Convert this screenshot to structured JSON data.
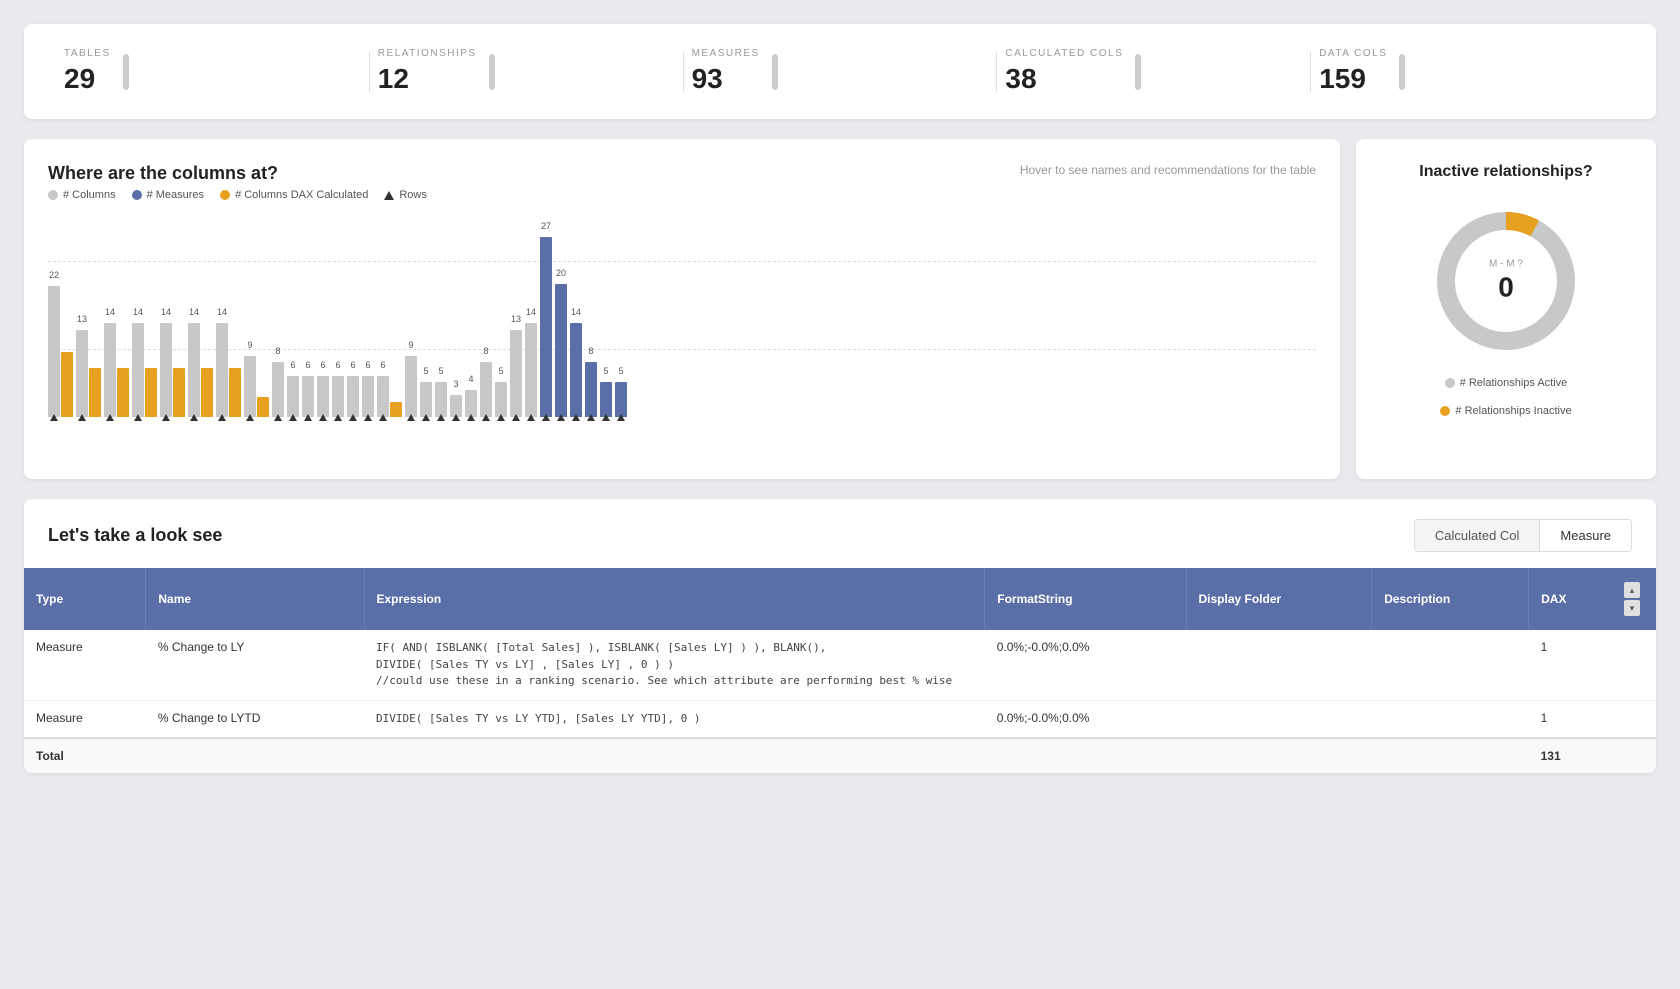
{
  "stats": {
    "items": [
      {
        "label": "TABLES",
        "value": "29"
      },
      {
        "label": "RELATIONSHIPS",
        "value": "12"
      },
      {
        "label": "MEASURES",
        "value": "93"
      },
      {
        "label": "CALCULATED COLS",
        "value": "38"
      },
      {
        "label": "DATA COLS",
        "value": "159"
      }
    ]
  },
  "columnChart": {
    "title": "Where are the columns at?",
    "subtitle": "Hover to see names and recommendations for the table",
    "legend": [
      {
        "label": "# Columns",
        "type": "dot",
        "color": "#c8c8c8"
      },
      {
        "label": "# Measures",
        "type": "dot",
        "color": "#5a6fa8"
      },
      {
        "label": "# Columns DAX Calculated",
        "type": "dot",
        "color": "#e8a020"
      },
      {
        "label": "Rows",
        "type": "triangle"
      }
    ],
    "bars": [
      {
        "grey": 120,
        "orange": 60,
        "blue": 0,
        "greyLabel": "22",
        "orangeLabel": "",
        "blueLabel": "",
        "hasTriangle": true
      },
      {
        "grey": 80,
        "orange": 45,
        "blue": 0,
        "greyLabel": "13",
        "orangeLabel": "",
        "blueLabel": "",
        "hasTriangle": true
      },
      {
        "grey": 86,
        "orange": 45,
        "blue": 0,
        "greyLabel": "14",
        "orangeLabel": "",
        "blueLabel": "",
        "hasTriangle": true
      },
      {
        "grey": 86,
        "orange": 45,
        "blue": 0,
        "greyLabel": "14",
        "orangeLabel": "",
        "blueLabel": "",
        "hasTriangle": true
      },
      {
        "grey": 86,
        "orange": 45,
        "blue": 0,
        "greyLabel": "14",
        "orangeLabel": "",
        "blueLabel": "",
        "hasTriangle": true
      },
      {
        "grey": 86,
        "orange": 45,
        "blue": 0,
        "greyLabel": "14",
        "orangeLabel": "",
        "blueLabel": "",
        "hasTriangle": true
      },
      {
        "grey": 86,
        "orange": 45,
        "blue": 0,
        "greyLabel": "14",
        "orangeLabel": "",
        "blueLabel": "",
        "hasTriangle": true
      },
      {
        "grey": 56,
        "orange": 18,
        "blue": 0,
        "greyLabel": "9",
        "orangeLabel": "",
        "blueLabel": "",
        "hasTriangle": true
      },
      {
        "grey": 50,
        "orange": 0,
        "blue": 0,
        "greyLabel": "8",
        "orangeLabel": "",
        "blueLabel": "",
        "hasTriangle": true
      },
      {
        "grey": 38,
        "orange": 0,
        "blue": 0,
        "greyLabel": "6",
        "orangeLabel": "",
        "blueLabel": "",
        "hasTriangle": true
      },
      {
        "grey": 38,
        "orange": 0,
        "blue": 0,
        "greyLabel": "6",
        "orangeLabel": "",
        "blueLabel": "",
        "hasTriangle": true
      },
      {
        "grey": 38,
        "orange": 0,
        "blue": 0,
        "greyLabel": "6",
        "orangeLabel": "",
        "blueLabel": "",
        "hasTriangle": true
      },
      {
        "grey": 38,
        "orange": 0,
        "blue": 0,
        "greyLabel": "6",
        "orangeLabel": "",
        "blueLabel": "",
        "hasTriangle": true
      },
      {
        "grey": 38,
        "orange": 0,
        "blue": 0,
        "greyLabel": "6",
        "orangeLabel": "",
        "blueLabel": "",
        "hasTriangle": true
      },
      {
        "grey": 38,
        "orange": 0,
        "blue": 0,
        "greyLabel": "6",
        "orangeLabel": "",
        "blueLabel": "",
        "hasTriangle": true
      },
      {
        "grey": 38,
        "orange": 14,
        "blue": 0,
        "greyLabel": "6",
        "orangeLabel": "",
        "blueLabel": "",
        "hasTriangle": true
      },
      {
        "grey": 56,
        "orange": 0,
        "blue": 0,
        "greyLabel": "9",
        "orangeLabel": "",
        "blueLabel": "",
        "hasTriangle": true
      },
      {
        "grey": 32,
        "orange": 0,
        "blue": 0,
        "greyLabel": "5",
        "orangeLabel": "",
        "blueLabel": "",
        "hasTriangle": true
      },
      {
        "grey": 32,
        "orange": 0,
        "blue": 0,
        "greyLabel": "5",
        "orangeLabel": "",
        "blueLabel": "",
        "hasTriangle": true
      },
      {
        "grey": 20,
        "orange": 0,
        "blue": 0,
        "greyLabel": "3",
        "orangeLabel": "",
        "blueLabel": "",
        "hasTriangle": true
      },
      {
        "grey": 25,
        "orange": 0,
        "blue": 0,
        "greyLabel": "4",
        "orangeLabel": "",
        "blueLabel": "",
        "hasTriangle": true
      },
      {
        "grey": 50,
        "orange": 0,
        "blue": 0,
        "greyLabel": "8",
        "orangeLabel": "",
        "blueLabel": "",
        "hasTriangle": true
      },
      {
        "grey": 32,
        "orange": 0,
        "blue": 0,
        "greyLabel": "5",
        "orangeLabel": "",
        "blueLabel": "",
        "hasTriangle": true
      },
      {
        "grey": 80,
        "orange": 0,
        "blue": 0,
        "greyLabel": "13",
        "orangeLabel": "",
        "blueLabel": "",
        "hasTriangle": true
      },
      {
        "grey": 86,
        "orange": 0,
        "blue": 0,
        "greyLabel": "14",
        "orangeLabel": "",
        "blueLabel": "",
        "hasTriangle": true
      },
      {
        "grey": 0,
        "orange": 0,
        "blue": 165,
        "greyLabel": "",
        "orangeLabel": "",
        "blueLabel": "27",
        "hasTriangle": true
      },
      {
        "grey": 0,
        "orange": 0,
        "blue": 122,
        "greyLabel": "",
        "orangeLabel": "",
        "blueLabel": "20",
        "hasTriangle": true
      },
      {
        "grey": 0,
        "orange": 0,
        "blue": 86,
        "greyLabel": "",
        "orangeLabel": "",
        "blueLabel": "14",
        "hasTriangle": true
      },
      {
        "grey": 0,
        "orange": 0,
        "blue": 50,
        "greyLabel": "",
        "orangeLabel": "",
        "blueLabel": "8",
        "hasTriangle": true
      },
      {
        "grey": 0,
        "orange": 0,
        "blue": 32,
        "greyLabel": "",
        "orangeLabel": "",
        "blueLabel": "5",
        "hasTriangle": true
      },
      {
        "grey": 0,
        "orange": 0,
        "blue": 32,
        "greyLabel": "",
        "orangeLabel": "",
        "blueLabel": "5",
        "hasTriangle": true
      }
    ]
  },
  "donut": {
    "title": "Inactive relationships?",
    "centerLabel": "M - M ?",
    "centerValue": "0",
    "activePercent": 92,
    "inactivePercent": 8,
    "colors": {
      "active": "#c8c8c8",
      "inactive": "#e8a020"
    },
    "legend": [
      {
        "label": "# Relationships Active",
        "color": "#c8c8c8"
      },
      {
        "label": "# Relationships Inactive",
        "color": "#e8a020"
      }
    ]
  },
  "table": {
    "sectionTitle": "Let's take a look see",
    "tabs": [
      {
        "label": "Calculated Col",
        "active": false
      },
      {
        "label": "Measure",
        "active": true
      }
    ],
    "columns": [
      {
        "label": "Type"
      },
      {
        "label": "Name"
      },
      {
        "label": "Expression"
      },
      {
        "label": "FormatString"
      },
      {
        "label": "Display Folder"
      },
      {
        "label": "Description"
      },
      {
        "label": "DAX"
      }
    ],
    "rows": [
      {
        "type": "Measure",
        "name": "% Change to LY",
        "expression": "IF( AND( ISBLANK( [Total Sales] ), ISBLANK( [Sales LY] ) ), BLANK(),\nDIVIDE( [Sales TY vs LY] , [Sales LY] , 0 ) )\n//could use these in a ranking scenario. See which attribute are performing best % wise",
        "formatString": "0.0%;-0.0%;0.0%",
        "displayFolder": "",
        "description": "",
        "dax": "1"
      },
      {
        "type": "Measure",
        "name": "% Change to LYTD",
        "expression": "DIVIDE( [Sales TY vs LY YTD], [Sales LY YTD], 0 )",
        "formatString": "0.0%;-0.0%;0.0%",
        "displayFolder": "",
        "description": "",
        "dax": "1"
      }
    ],
    "footer": {
      "label": "Total",
      "daxTotal": "131"
    }
  }
}
